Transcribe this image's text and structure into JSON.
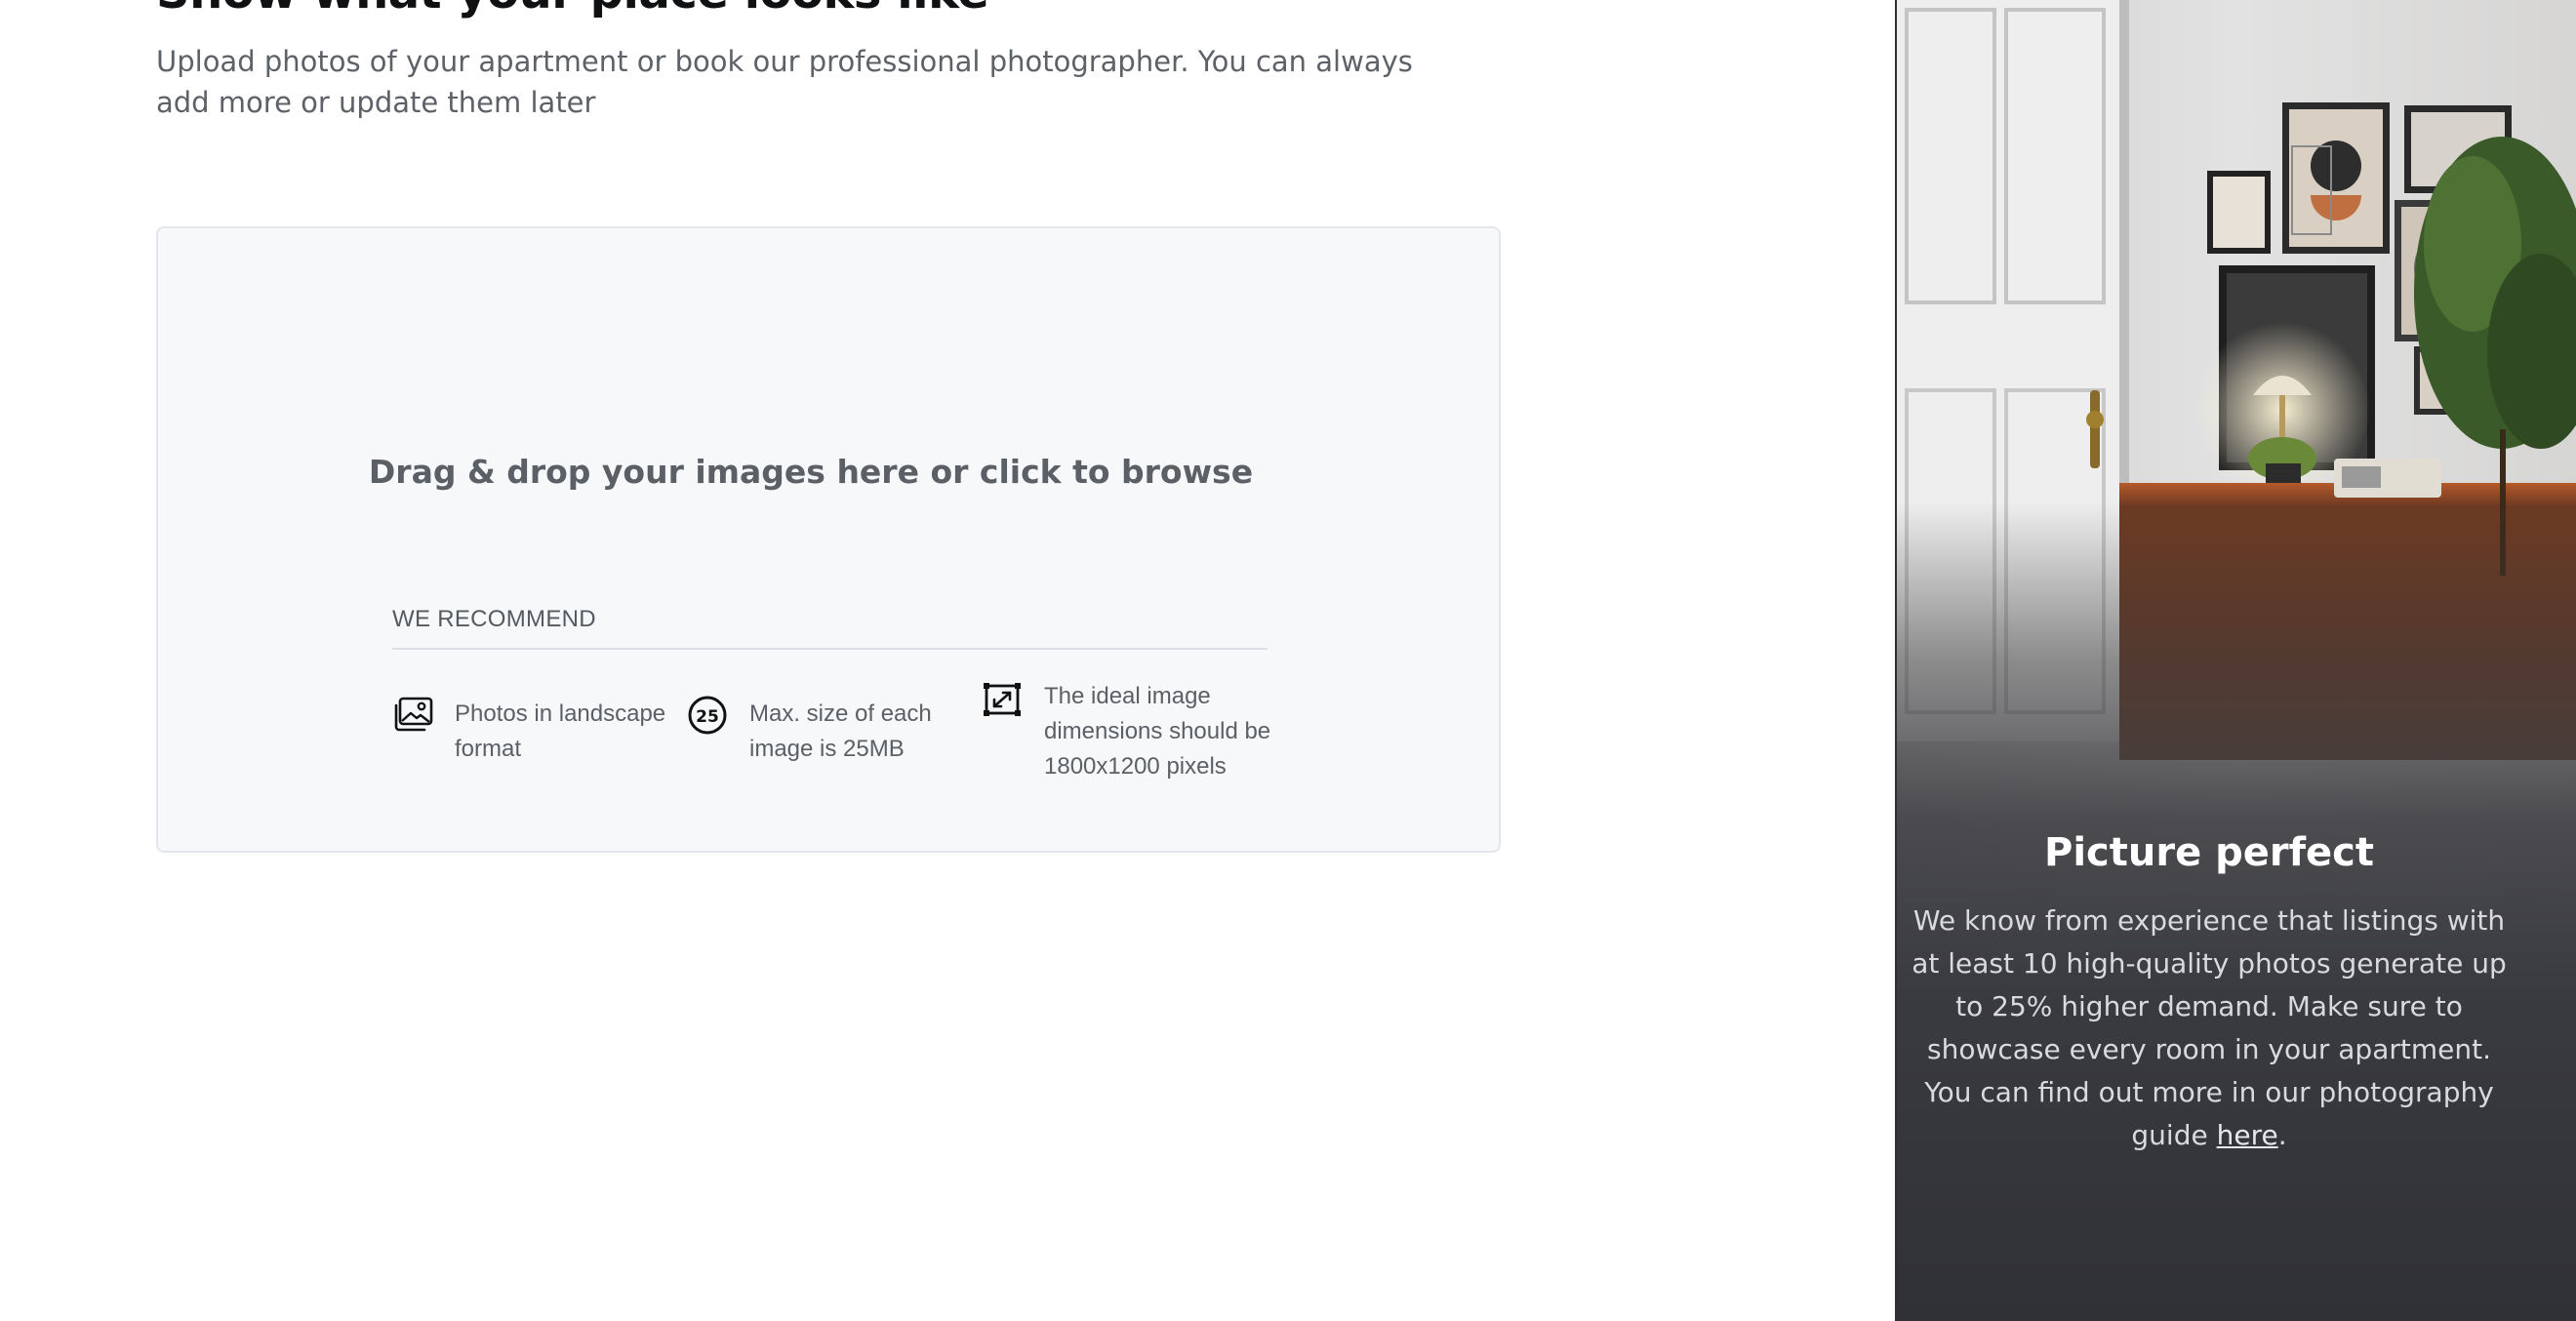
{
  "header": {
    "title": "Show what your place looks like",
    "subtitle": "Upload photos of your apartment or book our professional photographer. You can always add more or update them later"
  },
  "dropzone": {
    "prompt": "Drag & drop your images here or click to browse",
    "recommend_label": "WE RECOMMEND",
    "items": [
      {
        "icon": "landscape-photo-icon",
        "text": "Photos in landscape format"
      },
      {
        "icon": "size-25-icon",
        "icon_text": "25",
        "text": "Max. size of each image is 25MB"
      },
      {
        "icon": "dimensions-icon",
        "text": "The ideal image dimensions should be 1800x1200 pixels"
      }
    ]
  },
  "side_panel": {
    "title": "Picture perfect",
    "body_lines": [
      "We know from experience that listings with",
      "at least 10 high-quality photos generate up",
      "to 25% higher demand. Make sure to",
      "showcase every room in your apartment.",
      "You can find out more in our photography"
    ],
    "body_last_prefix": "guide ",
    "link_text": "here",
    "body_last_suffix": "."
  },
  "colors": {
    "title": "#0f1113",
    "muted_text": "#5d6268",
    "dropzone_bg": "#f7f8fa",
    "dropzone_border": "#e3e6ea",
    "panel_dark": "#3a3b3f",
    "panel_title": "#ffffff"
  }
}
